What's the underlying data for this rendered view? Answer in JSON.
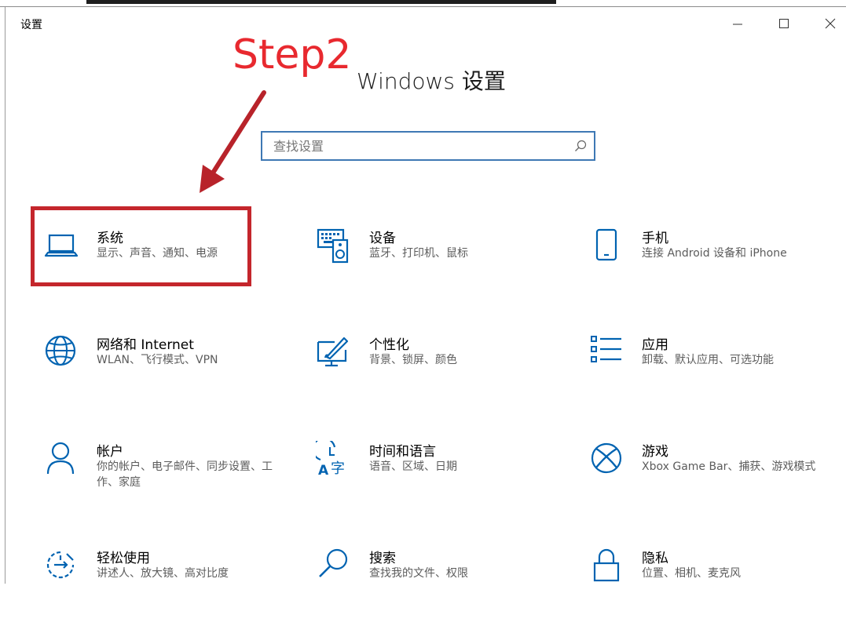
{
  "window": {
    "title": "设置",
    "minimize_icon": "minimize-icon",
    "maximize_icon": "maximize-icon",
    "close_icon": "close-icon"
  },
  "page": {
    "title": "Windows 设置"
  },
  "search": {
    "placeholder": "查找设置",
    "value": "",
    "icon": "search-icon"
  },
  "annotation": {
    "step_label": "Step2",
    "color": "#e8292f",
    "box_color": "#c4262c",
    "arrow_color": "#b8232a"
  },
  "tiles": [
    {
      "name": "系统",
      "desc": "显示、声音、通知、电源",
      "icon": "laptop-icon"
    },
    {
      "name": "设备",
      "desc": "蓝牙、打印机、鼠标",
      "icon": "keyboard-speaker-icon"
    },
    {
      "name": "手机",
      "desc": "连接 Android 设备和 iPhone",
      "icon": "phone-icon"
    },
    {
      "name": "网络和 Internet",
      "desc": "WLAN、飞行模式、VPN",
      "icon": "globe-icon"
    },
    {
      "name": "个性化",
      "desc": "背景、锁屏、颜色",
      "icon": "paint-brush-icon"
    },
    {
      "name": "应用",
      "desc": "卸载、默认应用、可选功能",
      "icon": "apps-list-icon"
    },
    {
      "name": "帐户",
      "desc": "你的帐户、电子邮件、同步设置、工作、家庭",
      "icon": "person-icon"
    },
    {
      "name": "时间和语言",
      "desc": "语音、区域、日期",
      "icon": "time-language-icon"
    },
    {
      "name": "游戏",
      "desc": "Xbox Game Bar、捕获、游戏模式",
      "icon": "xbox-icon"
    },
    {
      "name": "轻松使用",
      "desc": "讲述人、放大镜、高对比度",
      "icon": "ease-of-access-icon"
    },
    {
      "name": "搜索",
      "desc": "查找我的文件、权限",
      "icon": "search-magnifier-icon"
    },
    {
      "name": "隐私",
      "desc": "位置、相机、麦克风",
      "icon": "lock-icon"
    }
  ],
  "colors": {
    "accent": "#0063b1",
    "search_border": "#3e78b4",
    "desc_text": "#5c5c5c"
  }
}
